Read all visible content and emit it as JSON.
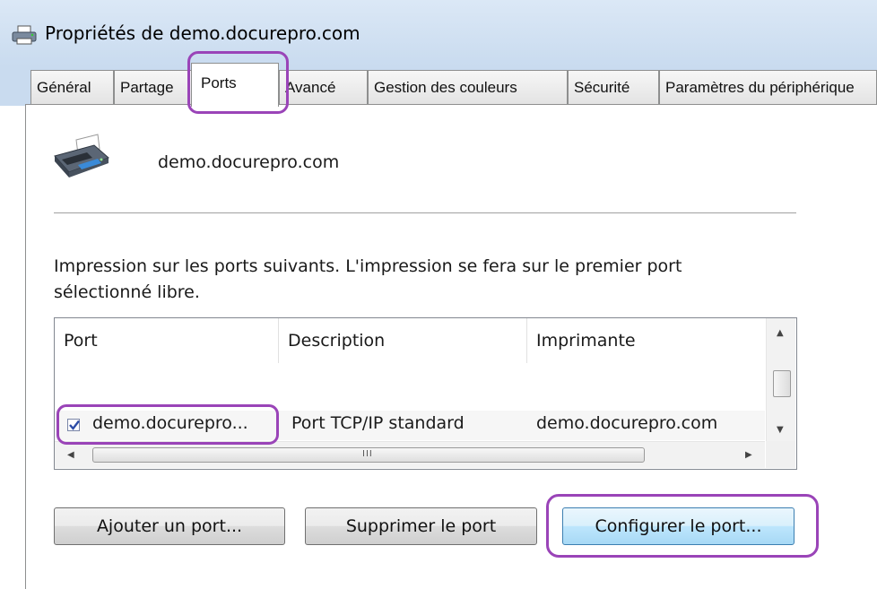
{
  "window": {
    "title": "Propriétés de demo.docurepro.com",
    "icon": "printer-icon"
  },
  "tabs": [
    {
      "label": "Général"
    },
    {
      "label": "Partage"
    },
    {
      "label": "Ports",
      "active": true
    },
    {
      "label": "Avancé"
    },
    {
      "label": "Gestion des couleurs"
    },
    {
      "label": "Sécurité"
    },
    {
      "label": "Paramètres du périphérique"
    }
  ],
  "printer": {
    "name": "demo.docurepro.com",
    "icon": "printer-icon"
  },
  "ports_section": {
    "description": "Impression sur les ports suivants. L'impression se fera sur le premier port sélectionné libre.",
    "columns": [
      "Port",
      "Description",
      "Imprimante"
    ],
    "rows": [
      {
        "checked": true,
        "port": "demo.docurepro...",
        "description": "Port TCP/IP standard",
        "printer": "demo.docurepro.com"
      }
    ],
    "scrollbar_grip": "III"
  },
  "buttons": {
    "add_port": "Ajouter un port...",
    "delete_port": "Supprimer le port",
    "configure_port": "Configurer le port..."
  },
  "colors": {
    "highlight": "#9a44b8",
    "titlebar": "#c9dbef",
    "default_button": "#bee6fd"
  }
}
